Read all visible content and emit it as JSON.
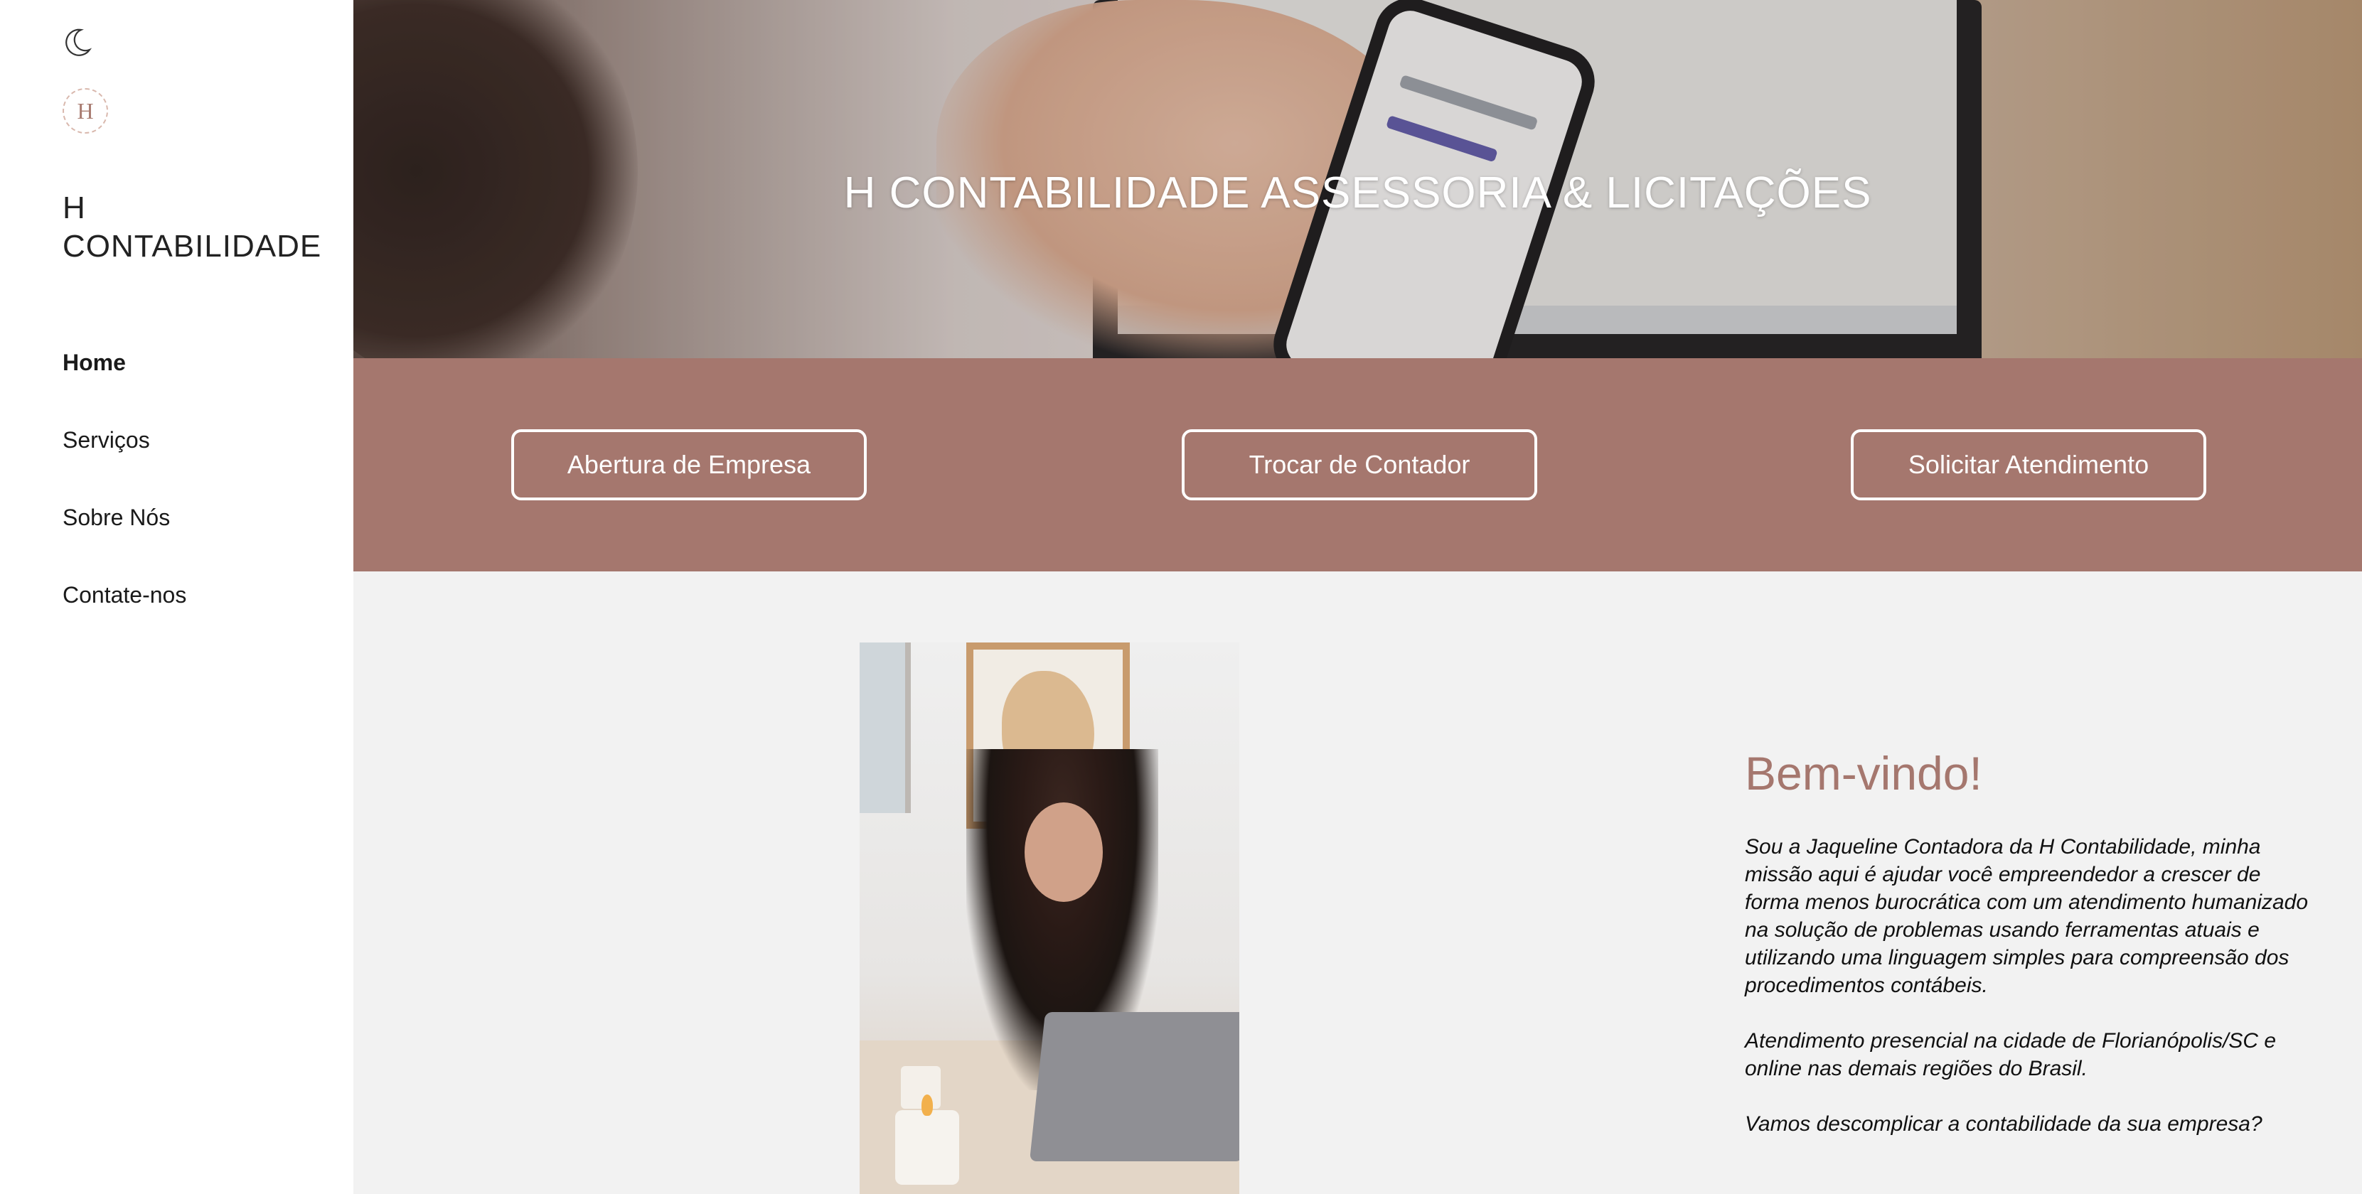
{
  "sidebar": {
    "theme_icon": "moon-icon",
    "logo_letter": "H",
    "brand": "H CONTABILIDADE",
    "nav": [
      {
        "label": "Home",
        "active": true
      },
      {
        "label": "Serviços",
        "active": false
      },
      {
        "label": "Sobre Nós",
        "active": false
      },
      {
        "label": "Contate-nos",
        "active": false
      }
    ]
  },
  "hero": {
    "title": "H CONTABILIDADE ASSESSORIA & LICITAÇÕES"
  },
  "actions": [
    {
      "label": "Abertura de Empresa"
    },
    {
      "label": "Trocar de Contador"
    },
    {
      "label": "Solicitar Atendimento"
    }
  ],
  "content": {
    "welcome": "Bem-vindo!",
    "paragraphs": [
      "Sou a Jaqueline Contadora da H Contabilidade, minha missão aqui é ajudar você empreendedor a crescer de forma menos burocrática com um atendimento humanizado na solução de problemas usando ferramentas atuais e utilizando uma linguagem simples para compreensão dos procedimentos contábeis.",
      "Atendimento presencial na cidade de Florianópolis/SC e online nas demais regiões do Brasil.",
      "Vamos descomplicar a contabilidade da sua empresa?"
    ]
  },
  "colors": {
    "accent": "#a5776e",
    "sidebar_bg": "#ffffff",
    "content_bg": "#f2f2f2"
  }
}
